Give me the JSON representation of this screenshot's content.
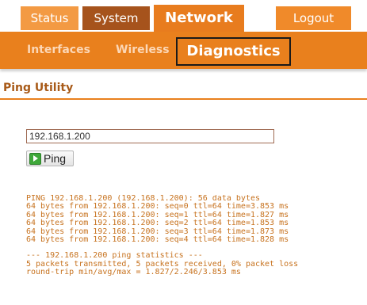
{
  "top_tabs": {
    "status": "Status",
    "system": "System",
    "network": "Network",
    "logout": "Logout"
  },
  "sub_nav": {
    "interfaces": "Interfaces",
    "wireless": "Wireless",
    "diagnostics": "Diagnostics"
  },
  "section": {
    "title": "Ping Utility"
  },
  "ping_form": {
    "ip_value": "192.168.1.200",
    "button_label": "Ping",
    "button_icon": "play-icon"
  },
  "output": {
    "lines": [
      "PING 192.168.1.200 (192.168.1.200): 56 data bytes",
      "64 bytes from 192.168.1.200: seq=0 ttl=64 time=3.853 ms",
      "64 bytes from 192.168.1.200: seq=1 ttl=64 time=1.827 ms",
      "64 bytes from 192.168.1.200: seq=2 ttl=64 time=1.853 ms",
      "64 bytes from 192.168.1.200: seq=3 ttl=64 time=1.873 ms",
      "64 bytes from 192.168.1.200: seq=4 ttl=64 time=1.828 ms"
    ],
    "stats_lines": [
      "--- 192.168.1.200 ping statistics ---",
      "5 packets transmitted, 5 packets received, 0% packet loss",
      "round-trip min/avg/max = 1.827/2.246/3.853 ms"
    ]
  },
  "colors": {
    "accent_orange": "#e9801d",
    "active_system_tab": "#a6531c",
    "output_text": "#c7721e",
    "heading_text": "#a85a18"
  }
}
